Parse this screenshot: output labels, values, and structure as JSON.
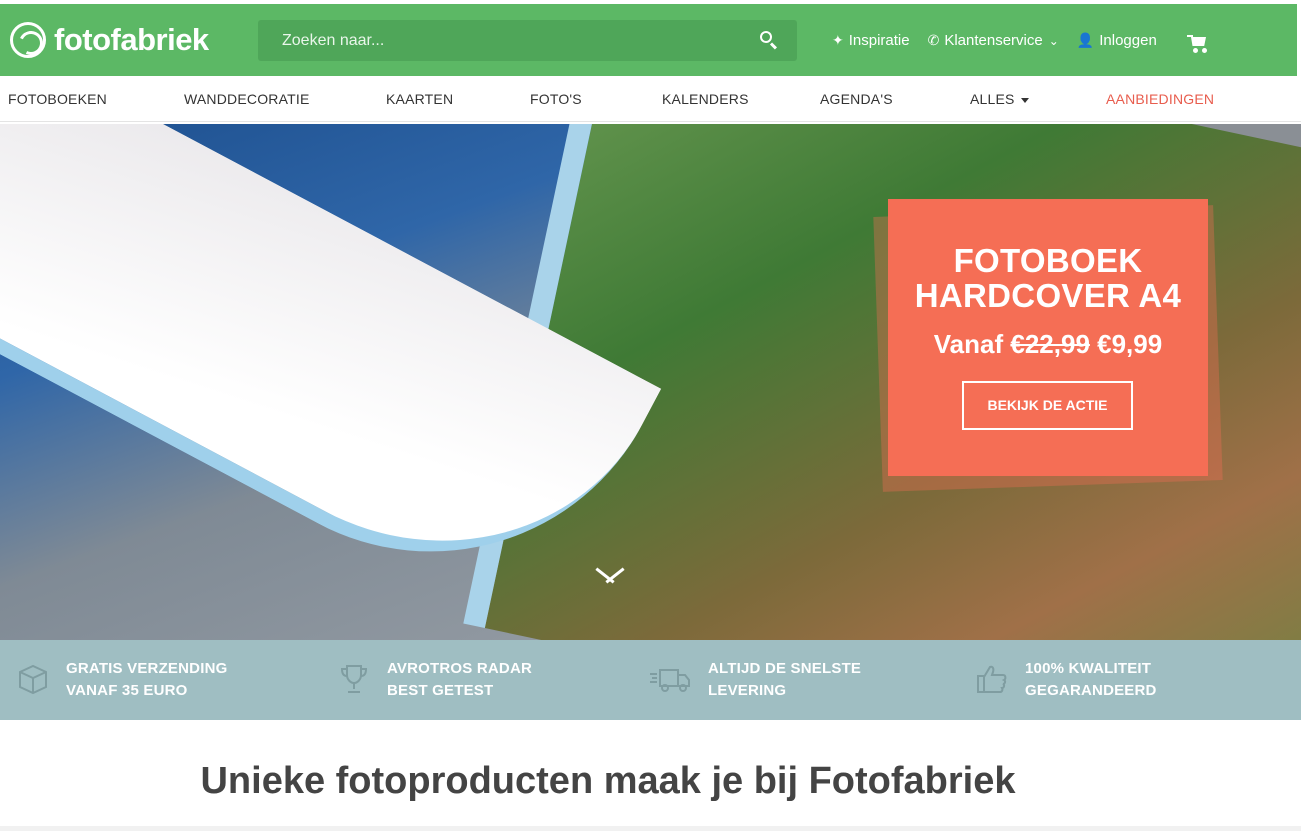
{
  "header": {
    "logo_text": "fotofabriek",
    "search_placeholder": "Zoeken naar...",
    "links": [
      {
        "label": "Inspiratie",
        "icon": "sparkle-icon"
      },
      {
        "label": "Klantenservice",
        "icon": "phone-icon"
      },
      {
        "label": "Inloggen",
        "icon": "user-icon"
      }
    ],
    "cart_icon": "cart-icon",
    "bg_color": "#5cb865"
  },
  "nav": {
    "items": [
      "FOTOBOEKEN",
      "WANDDECORATIE",
      "KAARTEN",
      "FOTO'S",
      "KALENDERS",
      "AGENDA'S",
      "ALLES",
      "AANBIEDINGEN"
    ],
    "promo_color": "#e85d4e"
  },
  "hero": {
    "title_line1": "FOTOBOEK",
    "title_line2": "HARDCOVER A4",
    "price_prefix": "Vanaf",
    "old_price": "€22,99",
    "new_price": "€9,99",
    "button_label": "BEKIJK DE ACTIE",
    "card_color": "#f56e55"
  },
  "usp": {
    "items": [
      {
        "line1": "GRATIS VERZENDING",
        "line2": "VANAF 35 EURO",
        "icon": "box-icon"
      },
      {
        "line1": "AVROTROS RADAR",
        "line2": "BEST GETEST",
        "icon": "trophy-icon"
      },
      {
        "line1": "ALTIJD DE SNELSTE",
        "line2": "LEVERING",
        "icon": "truck-icon"
      },
      {
        "line1": "100% KWALITEIT",
        "line2": "GEGARANDEERD",
        "icon": "thumbs-up-icon"
      }
    ],
    "bg_color": "#9fbec2"
  },
  "tagline": "Unieke fotoproducten maak je bij Fotofabriek"
}
